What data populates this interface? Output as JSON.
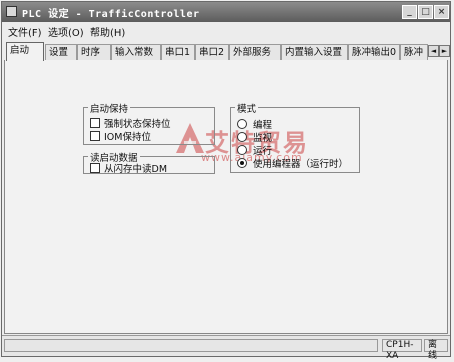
{
  "window": {
    "title": "PLC 设定 - TrafficController",
    "controls": [
      "_",
      "□",
      "×"
    ]
  },
  "menu": [
    "文件(F)",
    "选项(O)",
    "帮助(H)"
  ],
  "tabs": {
    "items": [
      "启动",
      "设置",
      "时序",
      "输入常数",
      "串口1",
      "串口2",
      "外部服务",
      "内置输入设置",
      "脉冲输出0",
      "脉冲"
    ],
    "active_index": 0,
    "scroll_left": "◄",
    "scroll_right": "►"
  },
  "startup_hold": {
    "title": "启动保持",
    "options": [
      {
        "label": "强制状态保持位",
        "checked": false
      },
      {
        "label": "IOM保持位",
        "checked": false
      }
    ]
  },
  "startup_read": {
    "title": "读启动数据",
    "options": [
      {
        "label": "从闪存中读DM",
        "checked": false
      }
    ]
  },
  "mode": {
    "title": "模式",
    "options": [
      {
        "label": "编程",
        "selected": false
      },
      {
        "label": "监视",
        "selected": false
      },
      {
        "label": "运行",
        "selected": false
      },
      {
        "label": "使用编程器（运行时）",
        "selected": true
      }
    ]
  },
  "watermark": {
    "brand": "艾特贸易",
    "url": "www.aiamy.com"
  },
  "statusbar": {
    "model": "CP1H-XA",
    "connection": "离线"
  }
}
